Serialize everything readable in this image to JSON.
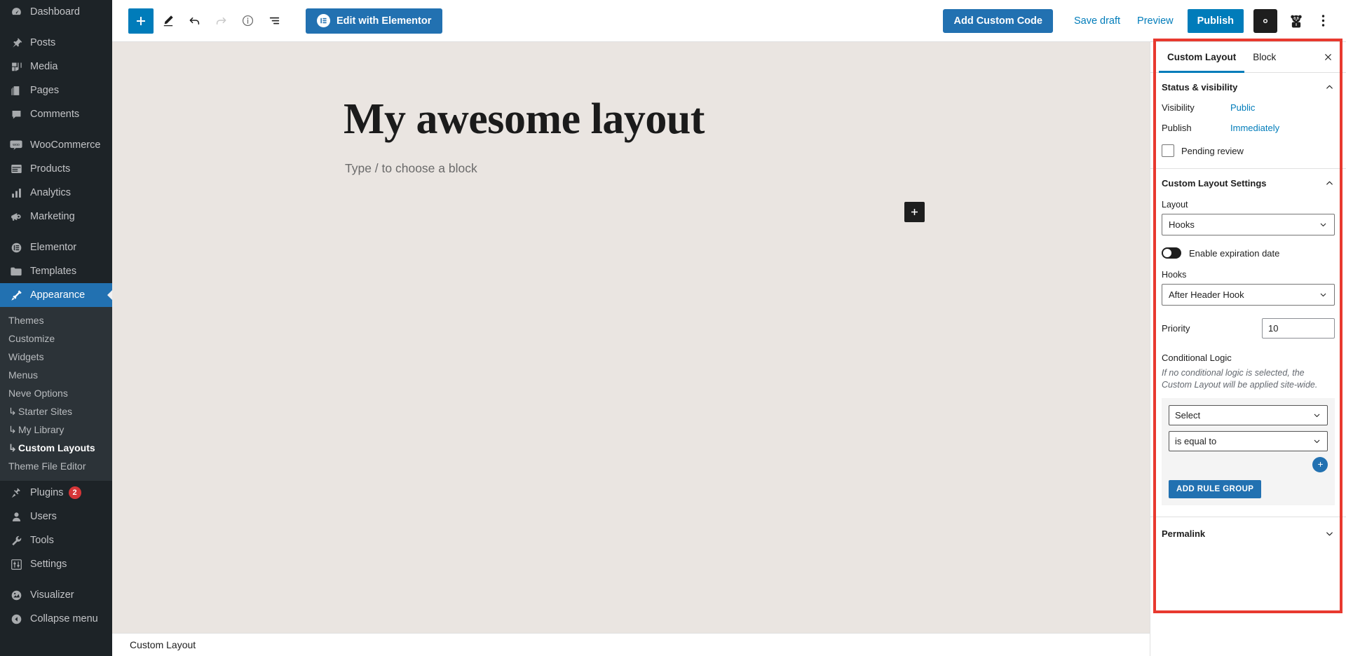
{
  "admin_sidebar": {
    "items": [
      {
        "label": "Dashboard",
        "icon": "dashboard-icon",
        "gap_after": true
      },
      {
        "label": "Posts",
        "icon": "pin-icon"
      },
      {
        "label": "Media",
        "icon": "media-icon"
      },
      {
        "label": "Pages",
        "icon": "pages-icon"
      },
      {
        "label": "Comments",
        "icon": "comments-icon",
        "gap_after": true
      },
      {
        "label": "WooCommerce",
        "icon": "woocommerce-icon"
      },
      {
        "label": "Products",
        "icon": "products-icon"
      },
      {
        "label": "Analytics",
        "icon": "analytics-icon"
      },
      {
        "label": "Marketing",
        "icon": "marketing-icon",
        "gap_after": true
      },
      {
        "label": "Elementor",
        "icon": "elementor-icon"
      },
      {
        "label": "Templates",
        "icon": "templates-icon"
      }
    ],
    "active_item": {
      "label": "Appearance",
      "icon": "appearance-icon"
    },
    "submenu": [
      {
        "label": "Themes",
        "nested": false,
        "current": false
      },
      {
        "label": "Customize",
        "nested": false,
        "current": false
      },
      {
        "label": "Widgets",
        "nested": false,
        "current": false
      },
      {
        "label": "Menus",
        "nested": false,
        "current": false
      },
      {
        "label": "Neve Options",
        "nested": false,
        "current": false
      },
      {
        "label": "Starter Sites",
        "nested": true,
        "current": false
      },
      {
        "label": "My Library",
        "nested": true,
        "current": false
      },
      {
        "label": "Custom Layouts",
        "nested": true,
        "current": true
      },
      {
        "label": "Theme File Editor",
        "nested": false,
        "current": false
      }
    ],
    "items_after": [
      {
        "label": "Plugins",
        "icon": "plugins-icon",
        "badge": "2"
      },
      {
        "label": "Users",
        "icon": "users-icon"
      },
      {
        "label": "Tools",
        "icon": "tools-icon"
      },
      {
        "label": "Settings",
        "icon": "settings-icon",
        "gap_after": true
      },
      {
        "label": "Visualizer",
        "icon": "visualizer-icon"
      },
      {
        "label": "Collapse menu",
        "icon": "collapse-icon"
      }
    ],
    "nested_arrow": "↳"
  },
  "toolbar": {
    "add_block_label": "+",
    "tools_icon": "pencil-icon",
    "undo_icon": "undo-arrow-icon",
    "redo_icon": "redo-arrow-icon",
    "info_icon": "info-icon",
    "list_view_icon": "list-view-icon",
    "elementor_label": "Edit with Elementor",
    "elementor_badge": "E",
    "add_custom_code": "Add Custom Code",
    "save_draft": "Save draft",
    "preview": "Preview",
    "publish": "Publish",
    "gear_icon": "gear-icon",
    "avatar_icon": "panda-avatar-icon",
    "kebab_icon": "more-options-icon"
  },
  "editor": {
    "post_title": "My awesome layout",
    "paragraph_placeholder": "Type / to choose a block",
    "inline_inserter_label": "+",
    "status_bar": "Custom Layout"
  },
  "panel": {
    "tabs": [
      {
        "label": "Custom Layout",
        "selected": true
      },
      {
        "label": "Block",
        "selected": false
      }
    ],
    "close_icon": "close-icon",
    "status_visibility": {
      "title": "Status & visibility",
      "collapse_icon": "chevron-up-icon",
      "visibility_label": "Visibility",
      "visibility_value": "Public",
      "publish_label": "Publish",
      "publish_value": "Immediately",
      "pending_review_label": "Pending review",
      "pending_review_checked": false
    },
    "custom_layout_settings": {
      "title": "Custom Layout Settings",
      "collapse_icon": "chevron-up-icon",
      "layout_label": "Layout",
      "layout_value": "Hooks",
      "expiration_toggle_label": "Enable expiration date",
      "expiration_toggle_on": false,
      "hooks_label": "Hooks",
      "hooks_value": "After Header Hook",
      "priority_label": "Priority",
      "priority_value": "10",
      "conditional_logic_title": "Conditional Logic",
      "conditional_logic_note": "If no conditional logic is selected, the Custom Layout will be applied site-wide.",
      "rule_field_value": "Select",
      "rule_operator_value": "is equal to",
      "add_rule_icon": "plus-circle-icon",
      "add_rule_group_label": "ADD RULE GROUP"
    },
    "permalink": {
      "title": "Permalink",
      "expand_icon": "chevron-down-icon"
    }
  },
  "colors": {
    "wp_sidebar_bg": "#1d2327",
    "wp_submenu_bg": "#2c3338",
    "accent_blue": "#007cba",
    "link_blue": "#2271b1",
    "canvas_bg": "#eae5e1",
    "highlight_red": "#e8392f",
    "badge_red": "#d63638"
  }
}
